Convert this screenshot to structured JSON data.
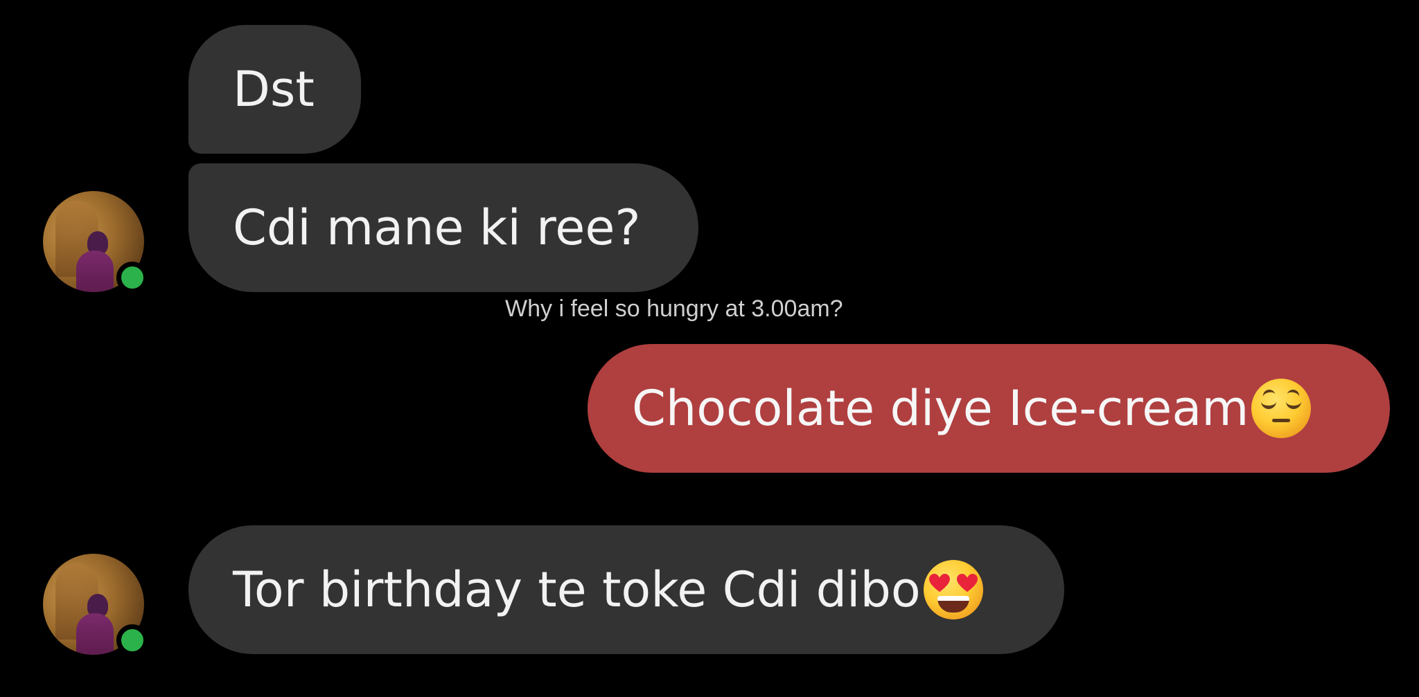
{
  "messages": [
    {
      "direction": "incoming",
      "text": "Dst"
    },
    {
      "direction": "incoming",
      "text": "Cdi mane ki ree?"
    },
    {
      "direction": "outgoing",
      "text": "Chocolate diye Ice-cream",
      "emoji": "relieved-face-emoji"
    },
    {
      "direction": "incoming",
      "text": "Tor birthday te toke Cdi dibo",
      "emoji": "heart-eyes-emoji"
    }
  ],
  "caption": "Why i feel so hungry at 3.00am?",
  "colors": {
    "background": "#000000",
    "incoming_bubble": "#333333",
    "outgoing_bubble": "#b03f40",
    "online_status": "#2bb24a"
  }
}
